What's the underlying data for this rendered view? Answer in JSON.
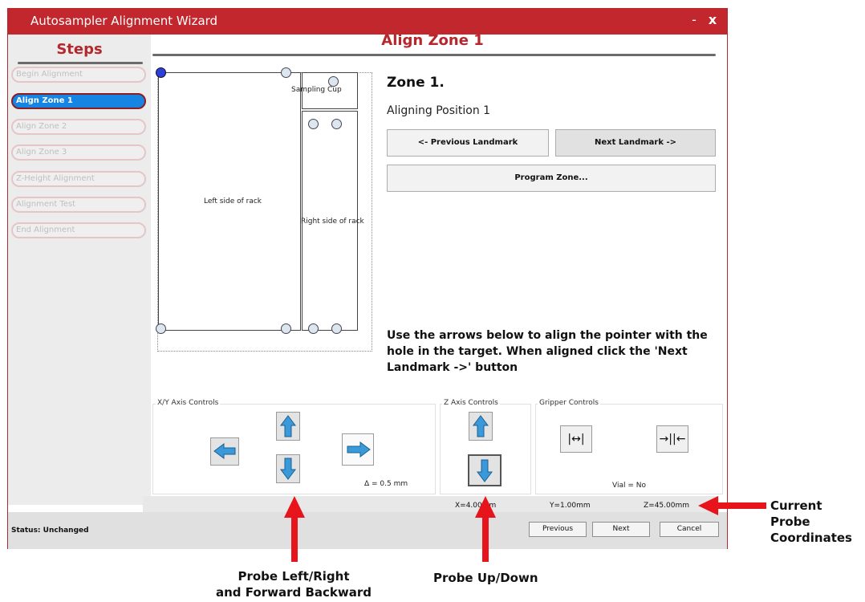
{
  "window": {
    "title": "Autosampler Alignment Wizard",
    "minimize": "-",
    "close": "x"
  },
  "sidebar": {
    "title": "Steps",
    "steps": [
      {
        "label": "Begin Alignment"
      },
      {
        "label": "Align Zone 1"
      },
      {
        "label": "Align Zone 2"
      },
      {
        "label": "Align Zone 3"
      },
      {
        "label": "Z-Height Alignment"
      },
      {
        "label": "Alignment Test"
      },
      {
        "label": "End Alignment"
      }
    ]
  },
  "main": {
    "title": "Align Zone 1",
    "rack": {
      "left_label": "Left side of rack",
      "right_label": "Right side of rack",
      "cup_label": "Sampling Cup"
    },
    "zone_heading": "Zone 1.",
    "zone_sub": "Aligning Position 1",
    "prev_landmark": "<- Previous Landmark",
    "next_landmark": "Next Landmark ->",
    "program_zone": "Program Zone...",
    "instructions": "Use the arrows below to align the pointer with the hole in the target. When aligned click the 'Next Landmark ->' button"
  },
  "controls": {
    "xy_label": "X/Y Axis Controls",
    "delta": "Δ = 0.5 mm",
    "z_label": "Z Axis Controls",
    "gripper_label": "Gripper Controls",
    "vial": "Vial = No",
    "open_glyph": "|↔|",
    "close_glyph": "→||←"
  },
  "coords": {
    "x": "X=4.00mm",
    "y": "Y=1.00mm",
    "z": "Z=45.00mm"
  },
  "status": {
    "text": "Status:  Unchanged"
  },
  "footer": {
    "previous": "Previous",
    "next": "Next",
    "cancel": "Cancel"
  },
  "annotations": {
    "current_coords": [
      "Current",
      "Probe",
      "Coordinates"
    ],
    "probe_xy": [
      "Probe Left/Right",
      "and Forward Backward"
    ],
    "probe_z": "Probe Up/Down"
  },
  "colors": {
    "titlebar": "#c1272d",
    "accent_red": "#b5272c",
    "active_step": "#1584e3",
    "arrow_blue": "#3a9ad9",
    "annotation_arrow": "#e8141c"
  }
}
